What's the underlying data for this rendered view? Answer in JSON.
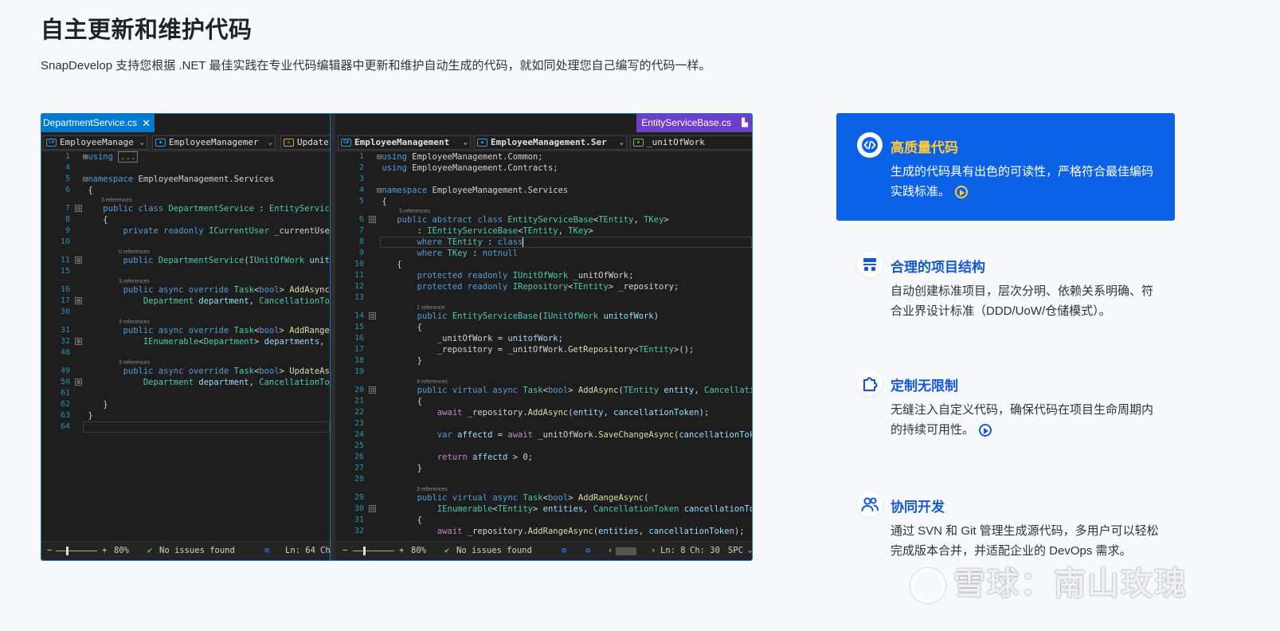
{
  "header": {
    "title": "自主更新和维护代码",
    "subtitle": "SnapDevelop 支持您根据 .NET 最佳实践在专业代码编辑器中更新和维护自动生成的代码，就如同处理您自己编写的代码一样。"
  },
  "ide": {
    "left": {
      "tab": "DepartmentService.cs",
      "nav": [
        "EmployeeManage",
        "EmployeeManagemer",
        "Update"
      ],
      "status": {
        "zoom": "80%",
        "issues": "No issues found",
        "ln": "Ln: 64",
        "ch": "Ch"
      }
    },
    "right": {
      "tab": "EntityServiceBase.cs",
      "nav": [
        "EmployeeManagement",
        "EmployeeManagement.Ser",
        "_unitOfWork"
      ],
      "status": {
        "zoom": "80%",
        "issues": "No issues found",
        "ln": "Ln: 8",
        "ch": "Ch: 30",
        "enc": "SPC"
      }
    }
  },
  "features": [
    {
      "title": "高质量代码",
      "desc": "生成的代码具有出色的可读性，严格符合最佳编码实践标准。",
      "icon": "code-icon",
      "active": true
    },
    {
      "title": "合理的项目结构",
      "desc": "自动创建标准项目，层次分明、依赖关系明确、符合业界设计标准（DDD/UoW/仓储模式）。",
      "icon": "structure-icon",
      "active": false
    },
    {
      "title": "定制无限制",
      "desc": "无缝注入自定义代码，确保代码在项目生命周期内的持续可用性。",
      "icon": "puzzle-icon",
      "active": false
    },
    {
      "title": "协同开发",
      "desc": "通过 SVN 和 Git 管理生成源代码，多用户可以轻松完成版本合并，并适配企业的 DevOps 需求。",
      "icon": "users-icon",
      "active": false
    }
  ],
  "watermark": "雪球：南山玫瑰",
  "colors": {
    "accent": "#0c62e6",
    "highlight": "#ffc93c",
    "link": "#1557d4"
  }
}
